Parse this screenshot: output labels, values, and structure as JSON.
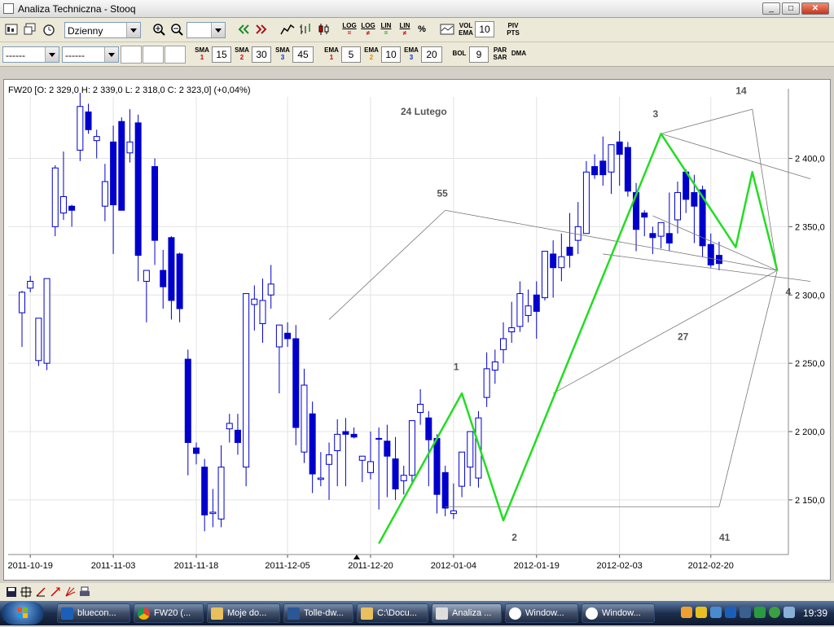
{
  "window": {
    "title": "Analiza Techniczna - Stooq",
    "btn_min": "_",
    "btn_max": "□",
    "btn_close": "✕"
  },
  "toolbar1": {
    "period_select": "Dzienny",
    "zoom_select": "",
    "log1_top": "LOG",
    "log1_bot": "=",
    "log2_top": "LOG",
    "log2_bot": "≠",
    "lin1_top": "LIN",
    "lin1_bot": "=",
    "lin2_top": "LIN",
    "lin2_bot": "≠",
    "percent": "%",
    "volema_top": "VOL",
    "volema_bot": "EMA",
    "volema_val": "10",
    "pivpts_top": "PIV",
    "pivpts_bot": "PTS"
  },
  "toolbar2": {
    "select1": "------",
    "select2": "------",
    "sma1_top": "SMA",
    "sma1_sub": "1",
    "sma1_val": "15",
    "sma2_top": "SMA",
    "sma2_sub": "2",
    "sma2_val": "30",
    "sma3_top": "SMA",
    "sma3_sub": "3",
    "sma3_val": "45",
    "ema1_top": "EMA",
    "ema1_sub": "1",
    "ema1_val": "5",
    "ema2_top": "EMA",
    "ema2_sub": "2",
    "ema2_val": "10",
    "ema3_top": "EMA",
    "ema3_sub": "3",
    "ema3_val": "20",
    "bol_label": "BOL",
    "bol_val": "9",
    "parsar_top": "PAR",
    "parsar_bot": "SAR",
    "dma_label": "DMA"
  },
  "chart_data": {
    "type": "candlestick",
    "title": "FW20 [O: 2 329,0  H: 2 339,0  L: 2 318,0  C: 2 323,0] (+0,04%)",
    "annotation": "24 Lutego",
    "x_tick_labels": [
      "2011-10-19",
      "2011-11-03",
      "2011-11-18",
      "2011-12-05",
      "2011-12-20",
      "2012-01-04",
      "2012-01-19",
      "2012-02-03",
      "2012-02-20"
    ],
    "y_tick_labels": [
      "2 400,0",
      "2 350,0",
      "2 300,0",
      "2 250,0",
      "2 200,0",
      "2 150,0"
    ],
    "ylim": [
      2110,
      2445
    ],
    "grid": true,
    "candles": [
      {
        "o": 2287,
        "h": 2303,
        "l": 2262,
        "c": 2302
      },
      {
        "o": 2305,
        "h": 2314,
        "l": 2302,
        "c": 2310
      },
      {
        "o": 2252,
        "h": 2282,
        "l": 2248,
        "c": 2283
      },
      {
        "o": 2250,
        "h": 2312,
        "l": 2245,
        "c": 2312
      },
      {
        "o": 2350,
        "h": 2395,
        "l": 2343,
        "c": 2393
      },
      {
        "o": 2360,
        "h": 2405,
        "l": 2355,
        "c": 2372
      },
      {
        "o": 2365,
        "h": 2366,
        "l": 2350,
        "c": 2362
      },
      {
        "o": 2406,
        "h": 2448,
        "l": 2398,
        "c": 2438
      },
      {
        "o": 2434,
        "h": 2440,
        "l": 2418,
        "c": 2421
      },
      {
        "o": 2413,
        "h": 2421,
        "l": 2400,
        "c": 2416
      },
      {
        "o": 2365,
        "h": 2396,
        "l": 2354,
        "c": 2383
      },
      {
        "o": 2412,
        "h": 2424,
        "l": 2330,
        "c": 2366
      },
      {
        "o": 2427,
        "h": 2430,
        "l": 2368,
        "c": 2362
      },
      {
        "o": 2404,
        "h": 2436,
        "l": 2397,
        "c": 2412
      },
      {
        "o": 2426,
        "h": 2432,
        "l": 2310,
        "c": 2329
      },
      {
        "o": 2310,
        "h": 2312,
        "l": 2280,
        "c": 2318
      },
      {
        "o": 2394,
        "h": 2400,
        "l": 2322,
        "c": 2340
      },
      {
        "o": 2318,
        "h": 2333,
        "l": 2290,
        "c": 2306
      },
      {
        "o": 2342,
        "h": 2343,
        "l": 2282,
        "c": 2296
      },
      {
        "o": 2330,
        "h": 2331,
        "l": 2280,
        "c": 2290
      },
      {
        "o": 2253,
        "h": 2260,
        "l": 2168,
        "c": 2192
      },
      {
        "o": 2188,
        "h": 2192,
        "l": 2176,
        "c": 2184
      },
      {
        "o": 2174,
        "h": 2180,
        "l": 2127,
        "c": 2139
      },
      {
        "o": 2140,
        "h": 2158,
        "l": 2130,
        "c": 2141
      },
      {
        "o": 2136,
        "h": 2190,
        "l": 2130,
        "c": 2174
      },
      {
        "o": 2202,
        "h": 2213,
        "l": 2192,
        "c": 2206
      },
      {
        "o": 2201,
        "h": 2213,
        "l": 2183,
        "c": 2192
      },
      {
        "o": 2174,
        "h": 2290,
        "l": 2160,
        "c": 2301
      },
      {
        "o": 2293,
        "h": 2307,
        "l": 2274,
        "c": 2297
      },
      {
        "o": 2279,
        "h": 2312,
        "l": 2265,
        "c": 2296
      },
      {
        "o": 2300,
        "h": 2322,
        "l": 2290,
        "c": 2308
      },
      {
        "o": 2262,
        "h": 2270,
        "l": 2228,
        "c": 2278
      },
      {
        "o": 2272,
        "h": 2280,
        "l": 2262,
        "c": 2268
      },
      {
        "o": 2268,
        "h": 2278,
        "l": 2190,
        "c": 2203
      },
      {
        "o": 2185,
        "h": 2246,
        "l": 2177,
        "c": 2234
      },
      {
        "o": 2213,
        "h": 2222,
        "l": 2155,
        "c": 2169
      },
      {
        "o": 2165,
        "h": 2185,
        "l": 2160,
        "c": 2166
      },
      {
        "o": 2176,
        "h": 2192,
        "l": 2150,
        "c": 2183
      },
      {
        "o": 2186,
        "h": 2209,
        "l": 2160,
        "c": 2198
      },
      {
        "o": 2200,
        "h": 2210,
        "l": 2160,
        "c": 2198
      },
      {
        "o": 2198,
        "h": 2203,
        "l": 2195,
        "c": 2196
      },
      {
        "o": 2179,
        "h": 2180,
        "l": 2163,
        "c": 2182
      },
      {
        "o": 2170,
        "h": 2200,
        "l": 2165,
        "c": 2178
      },
      {
        "o": 2195,
        "h": 2203,
        "l": 2143,
        "c": 2195
      },
      {
        "o": 2193,
        "h": 2205,
        "l": 2152,
        "c": 2182
      },
      {
        "o": 2180,
        "h": 2196,
        "l": 2150,
        "c": 2158
      },
      {
        "o": 2164,
        "h": 2175,
        "l": 2154,
        "c": 2168
      },
      {
        "o": 2168,
        "h": 2203,
        "l": 2162,
        "c": 2208
      },
      {
        "o": 2214,
        "h": 2231,
        "l": 2205,
        "c": 2220
      },
      {
        "o": 2210,
        "h": 2215,
        "l": 2160,
        "c": 2194
      },
      {
        "o": 2195,
        "h": 2198,
        "l": 2140,
        "c": 2154
      },
      {
        "o": 2170,
        "h": 2175,
        "l": 2138,
        "c": 2144
      },
      {
        "o": 2140,
        "h": 2162,
        "l": 2136,
        "c": 2142
      },
      {
        "o": 2160,
        "h": 2170,
        "l": 2152,
        "c": 2185
      },
      {
        "o": 2174,
        "h": 2196,
        "l": 2160,
        "c": 2200
      },
      {
        "o": 2166,
        "h": 2215,
        "l": 2159,
        "c": 2210
      },
      {
        "o": 2225,
        "h": 2258,
        "l": 2218,
        "c": 2246
      },
      {
        "o": 2245,
        "h": 2260,
        "l": 2235,
        "c": 2251
      },
      {
        "o": 2260,
        "h": 2280,
        "l": 2250,
        "c": 2268
      },
      {
        "o": 2273,
        "h": 2295,
        "l": 2265,
        "c": 2276
      },
      {
        "o": 2277,
        "h": 2310,
        "l": 2273,
        "c": 2301
      },
      {
        "o": 2285,
        "h": 2304,
        "l": 2280,
        "c": 2292
      },
      {
        "o": 2300,
        "h": 2310,
        "l": 2268,
        "c": 2288
      },
      {
        "o": 2298,
        "h": 2327,
        "l": 2296,
        "c": 2332
      },
      {
        "o": 2330,
        "h": 2340,
        "l": 2298,
        "c": 2320
      },
      {
        "o": 2320,
        "h": 2345,
        "l": 2310,
        "c": 2328
      },
      {
        "o": 2335,
        "h": 2360,
        "l": 2320,
        "c": 2329
      },
      {
        "o": 2340,
        "h": 2368,
        "l": 2330,
        "c": 2350
      },
      {
        "o": 2345,
        "h": 2398,
        "l": 2345,
        "c": 2390
      },
      {
        "o": 2394,
        "h": 2403,
        "l": 2385,
        "c": 2388
      },
      {
        "o": 2398,
        "h": 2416,
        "l": 2380,
        "c": 2388
      },
      {
        "o": 2390,
        "h": 2408,
        "l": 2374,
        "c": 2410
      },
      {
        "o": 2412,
        "h": 2420,
        "l": 2380,
        "c": 2403
      },
      {
        "o": 2408,
        "h": 2412,
        "l": 2372,
        "c": 2376
      },
      {
        "o": 2375,
        "h": 2382,
        "l": 2332,
        "c": 2348
      },
      {
        "o": 2360,
        "h": 2362,
        "l": 2343,
        "c": 2357
      },
      {
        "o": 2345,
        "h": 2350,
        "l": 2330,
        "c": 2342
      },
      {
        "o": 2343,
        "h": 2350,
        "l": 2334,
        "c": 2353
      },
      {
        "o": 2345,
        "h": 2375,
        "l": 2332,
        "c": 2338
      },
      {
        "o": 2355,
        "h": 2383,
        "l": 2345,
        "c": 2375
      },
      {
        "o": 2390,
        "h": 2392,
        "l": 2360,
        "c": 2370
      },
      {
        "o": 2375,
        "h": 2388,
        "l": 2338,
        "c": 2365
      },
      {
        "o": 2377,
        "h": 2380,
        "l": 2328,
        "c": 2336
      },
      {
        "o": 2337,
        "h": 2345,
        "l": 2320,
        "c": 2322
      },
      {
        "o": 2329,
        "h": 2339,
        "l": 2318,
        "c": 2323
      }
    ],
    "wave_labels": [
      "1",
      "2",
      "3",
      "4"
    ],
    "fan_labels": [
      "55",
      "27",
      "41",
      "14"
    ]
  },
  "bottom": {},
  "taskbar": {
    "tasks": [
      "bluecon...",
      "FW20 (...",
      "Moje do...",
      "Tolle-dw...",
      "C:\\Docu...",
      "Analiza ...",
      "Window...",
      "Window..."
    ],
    "clock": "19:39"
  }
}
